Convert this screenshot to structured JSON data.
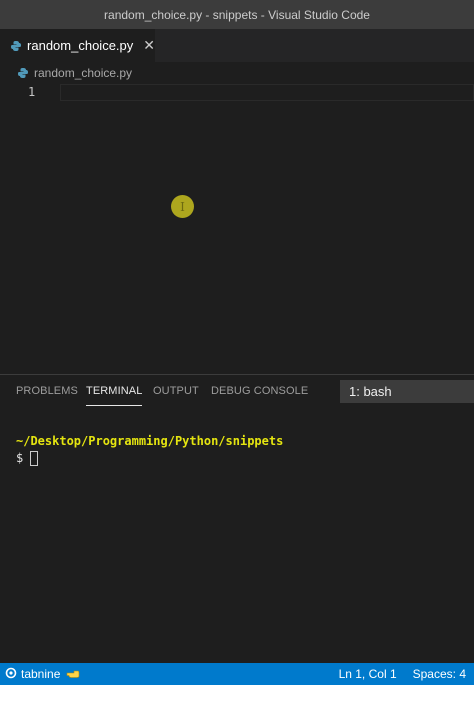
{
  "window": {
    "title": "random_choice.py - snippets - Visual Studio Code"
  },
  "tabs": [
    {
      "label": "random_choice.py",
      "active": true
    }
  ],
  "breadcrumb": {
    "file": "random_choice.py"
  },
  "editor": {
    "line_numbers": [
      "1"
    ],
    "content": ""
  },
  "panel": {
    "tabs": [
      {
        "label": "PROBLEMS",
        "active": false
      },
      {
        "label": "TERMINAL",
        "active": true
      },
      {
        "label": "OUTPUT",
        "active": false
      },
      {
        "label": "DEBUG CONSOLE",
        "active": false
      }
    ],
    "terminal_selector": "1: bash"
  },
  "terminal": {
    "path": "~/Desktop/Programming/Python/snippets",
    "prompt": "$"
  },
  "statusbar": {
    "left": {
      "label": "tabnine"
    },
    "right": {
      "position": "Ln 1, Col 1",
      "indent": "Spaces: 4"
    }
  },
  "colors": {
    "accent": "#007acc",
    "terminal_path": "#e5e510",
    "editor_bg": "#1e1e1e",
    "python_icon": "#519aba",
    "mouse_highlight": "#c7be1e"
  },
  "icons": {
    "file_icon": "python-file-icon",
    "close": "close-icon",
    "status_left": "tabnine-icon",
    "status_hand": "hand-icon",
    "mouse": "mouse-cursor-icon"
  }
}
